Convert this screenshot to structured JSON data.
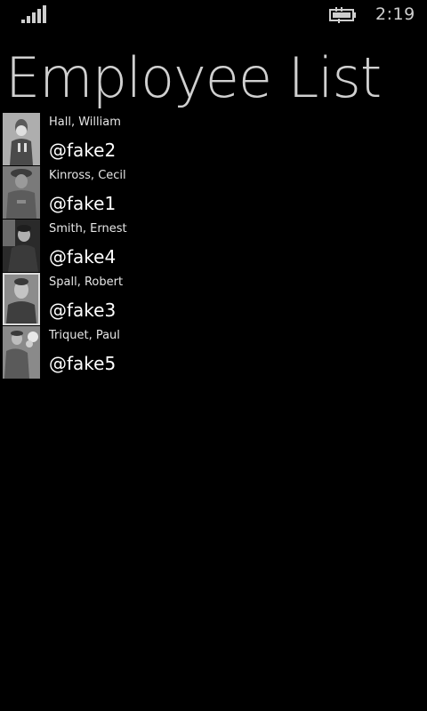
{
  "status_bar": {
    "signal_icon": "signal-strength-icon",
    "battery_icon": "battery-charging-icon",
    "time": "2:19"
  },
  "page": {
    "title": "Employee List"
  },
  "employees": [
    {
      "name": "Hall, William",
      "handle": "@fake2",
      "photo_icon": "employee-photo"
    },
    {
      "name": "Kinross, Cecil",
      "handle": "@fake1",
      "photo_icon": "employee-photo"
    },
    {
      "name": "Smith, Ernest",
      "handle": "@fake4",
      "photo_icon": "employee-photo"
    },
    {
      "name": "Spall, Robert",
      "handle": "@fake3",
      "photo_icon": "employee-photo"
    },
    {
      "name": "Triquet, Paul",
      "handle": "@fake5",
      "photo_icon": "employee-photo"
    }
  ]
}
